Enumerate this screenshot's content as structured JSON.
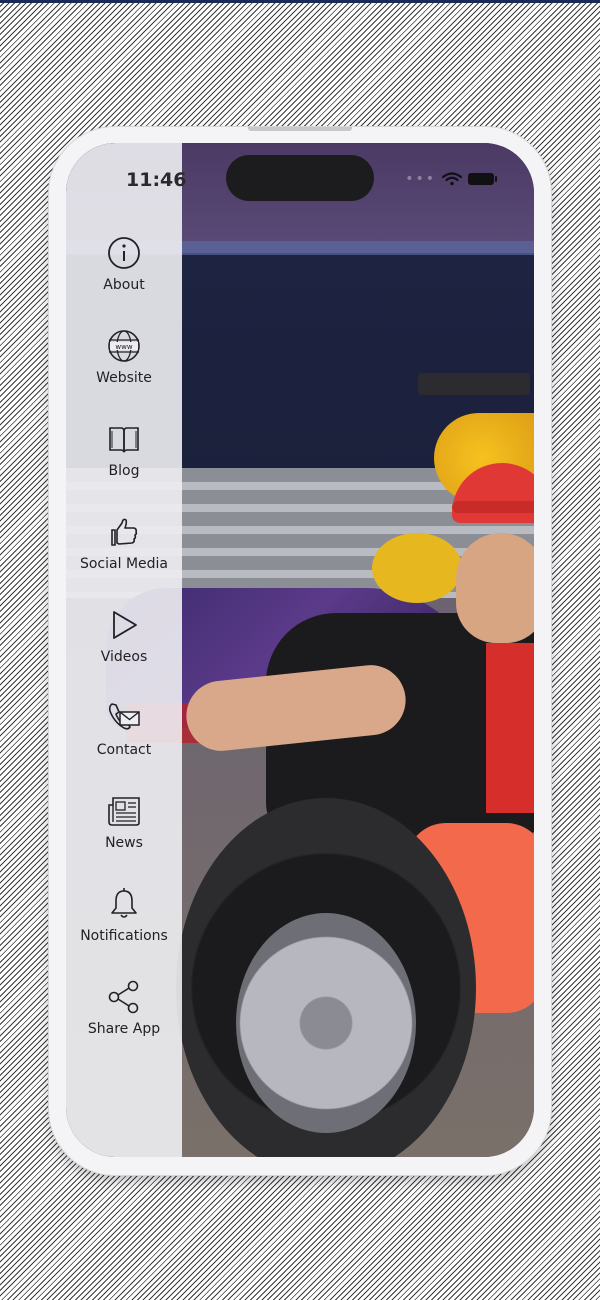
{
  "status_bar": {
    "time": "11:46",
    "icons": [
      "wifi-icon",
      "battery-icon"
    ]
  },
  "menu": {
    "items": [
      {
        "label": "About",
        "icon": "info-icon"
      },
      {
        "label": "Website",
        "icon": "globe-www-icon"
      },
      {
        "label": "Blog",
        "icon": "open-book-icon"
      },
      {
        "label": "Social Media",
        "icon": "thumbs-up-icon"
      },
      {
        "label": "Videos",
        "icon": "play-icon"
      },
      {
        "label": "Contact",
        "icon": "phone-mail-icon"
      },
      {
        "label": "News",
        "icon": "newspaper-icon"
      },
      {
        "label": "Notifications",
        "icon": "bell-icon"
      },
      {
        "label": "Share App",
        "icon": "share-icon"
      }
    ]
  },
  "colors": {
    "menu_background": "#eeeef2",
    "menu_text": "#222226",
    "frame": "#f4f4f6"
  }
}
